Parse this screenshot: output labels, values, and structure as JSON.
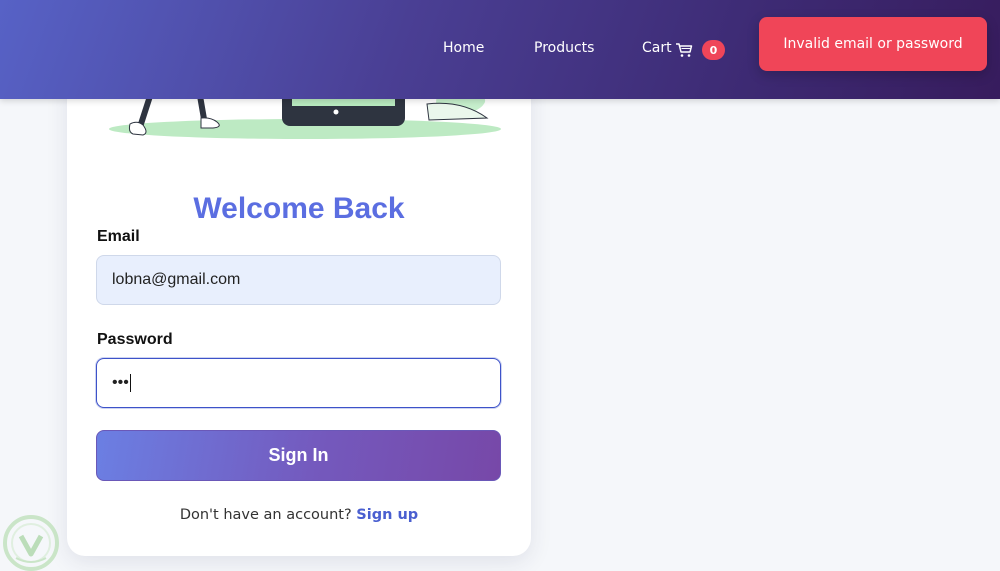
{
  "nav": {
    "home": "Home",
    "products": "Products",
    "cart": "Cart",
    "cart_count": "0",
    "cart_icon": "shopping-cart-icon"
  },
  "toast": {
    "message": "Invalid email or password"
  },
  "login": {
    "title": "Welcome Back",
    "email_label": "Email",
    "email_value": "lobna@gmail.com",
    "password_label": "Password",
    "password_value": "•••",
    "submit_label": "Sign In",
    "signup_prompt": "Don't have an account?",
    "signup_link": "Sign up"
  },
  "colors": {
    "header_start": "#5762c6",
    "header_end": "#371c5d",
    "title": "#5b6ee1",
    "toast_bg": "#f04558",
    "badge_bg": "#ef4559",
    "link": "#4a5fd0",
    "button_start": "#6b7fe3",
    "button_end": "#7748a8"
  }
}
